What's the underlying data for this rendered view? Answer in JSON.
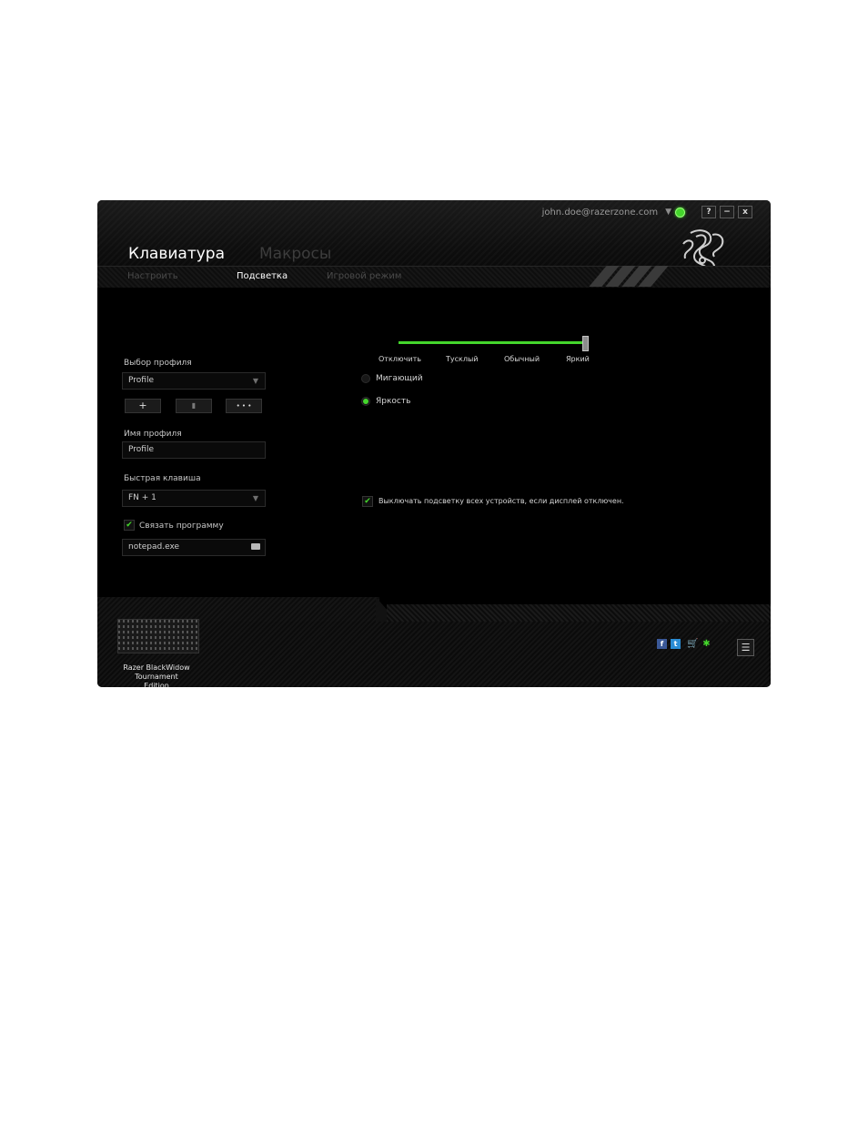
{
  "account": {
    "email": "john.doe@razerzone.com"
  },
  "window_buttons": {
    "help": "?",
    "minimize": "−",
    "close": "x"
  },
  "main_tabs": {
    "keyboard": "Клавиатура",
    "macros": "Макросы"
  },
  "sub_tabs": {
    "customize": "Настроить",
    "lighting": "Подсветка",
    "gaming_mode": "Игровой режим"
  },
  "profile": {
    "select_label": "Выбор профиля",
    "selected": "Profile",
    "add_button": "+",
    "delete_button": "▮",
    "more_button": "• • •",
    "name_label": "Имя профиля",
    "name_value": "Profile",
    "hotkey_label": "Быстрая клавиша",
    "hotkey_value": "FN + 1",
    "link_program_label": "Связать программу",
    "link_program_checked": true,
    "program_value": "notepad.exe"
  },
  "lighting": {
    "blinking_label": "Мигающий",
    "brightness_label": "Яркость",
    "selected_mode": "brightness",
    "brightness_levels": [
      "Отключить",
      "Тусклый",
      "Обычный",
      "Яркий"
    ],
    "brightness_selected": "Яркий",
    "display_off_label": "Выключать подсветку всех устройств, если дисплей отключен.",
    "display_off_checked": true
  },
  "footer": {
    "device_name_line1": "Razer BlackWidow",
    "device_name_line2": "Tournament Edition",
    "menu_icon": "☰"
  },
  "colors": {
    "accent": "#44d62c",
    "background": "#000000"
  }
}
